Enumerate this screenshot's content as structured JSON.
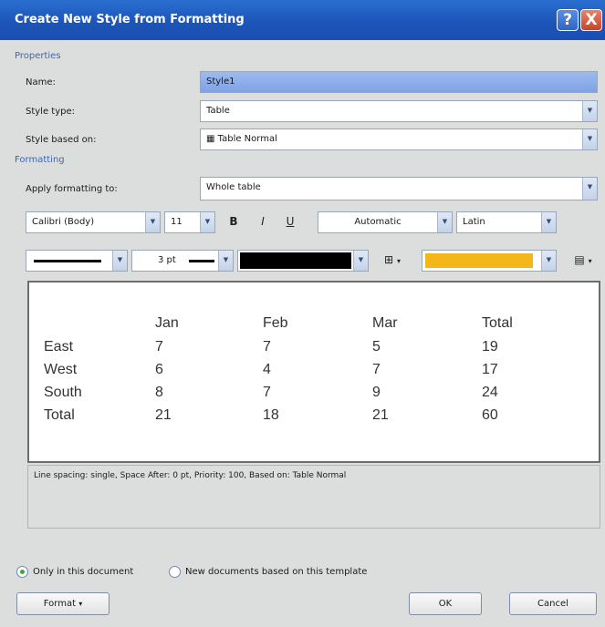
{
  "window": {
    "title": "Create New Style from Formatting",
    "help_icon": "?",
    "close_icon": "X"
  },
  "properties": {
    "section": "Properties",
    "name_label": "Name:",
    "name_value": "Style1",
    "type_label": "Style type:",
    "type_value": "Table",
    "based_label": "Style based on:",
    "based_value": "Table Normal"
  },
  "formatting": {
    "section": "Formatting",
    "apply_label": "Apply formatting to:",
    "apply_value": "Whole table",
    "font": "Calibri (Body)",
    "size": "11",
    "bold": "B",
    "italic": "I",
    "underline": "U",
    "color": "Automatic",
    "language": "Latin",
    "line_weight": "3 pt",
    "border_color": "#000000",
    "shading_color": "#f3b71a"
  },
  "preview": {
    "headers": [
      "",
      "Jan",
      "Feb",
      "Mar",
      "Total"
    ],
    "rows": [
      [
        "East",
        "7",
        "7",
        "5",
        "19"
      ],
      [
        "West",
        "6",
        "4",
        "7",
        "17"
      ],
      [
        "South",
        "8",
        "7",
        "9",
        "24"
      ],
      [
        "Total",
        "21",
        "18",
        "21",
        "60"
      ]
    ]
  },
  "description": "Line spacing:  single, Space After:  0 pt, Priority: 100, Based on: Table Normal",
  "options": {
    "only_doc": "Only in this document",
    "new_docs": "New documents based on this template",
    "selected": "only_doc"
  },
  "buttons": {
    "format": "Format",
    "ok": "OK",
    "cancel": "Cancel"
  }
}
